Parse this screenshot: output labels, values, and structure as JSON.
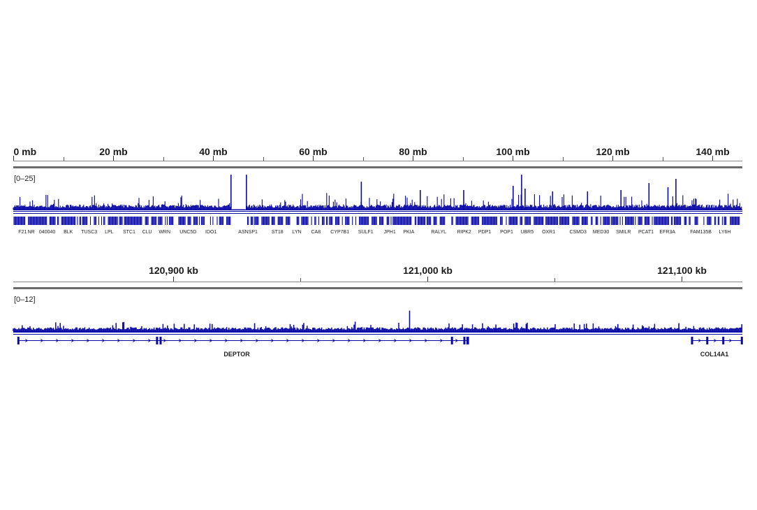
{
  "colors": {
    "signal": "#0a0aa8",
    "axis": "#4a4a4a",
    "rule": "#6b6b6b"
  },
  "chart_data": [
    {
      "type": "area",
      "title": "",
      "x_unit": "mb",
      "xlim": [
        0,
        146
      ],
      "x_ticks": [
        {
          "value": 0,
          "label": "0 mb"
        },
        {
          "value": 20,
          "label": "20 mb"
        },
        {
          "value": 40,
          "label": "40 mb"
        },
        {
          "value": 60,
          "label": "60 mb"
        },
        {
          "value": 80,
          "label": "80 mb"
        },
        {
          "value": 100,
          "label": "100 mb"
        },
        {
          "value": 120,
          "label": "120 mb"
        },
        {
          "value": 140,
          "label": "140 mb"
        }
      ],
      "data_range_label": "[0–25]",
      "ylim": [
        0,
        25
      ],
      "baseline_level": 2.5,
      "gap_region": [
        43.8,
        46.5
      ],
      "peaks": [
        {
          "x": 43.6,
          "y": 25
        },
        {
          "x": 46.7,
          "y": 25
        },
        {
          "x": 69.7,
          "y": 20
        },
        {
          "x": 101.8,
          "y": 25
        },
        {
          "x": 100.1,
          "y": 17
        },
        {
          "x": 102.5,
          "y": 15
        },
        {
          "x": 108.0,
          "y": 13
        },
        {
          "x": 90.2,
          "y": 14
        },
        {
          "x": 127.3,
          "y": 19
        },
        {
          "x": 131.1,
          "y": 16
        },
        {
          "x": 132.7,
          "y": 22
        },
        {
          "x": 115.0,
          "y": 13
        },
        {
          "x": 121.7,
          "y": 14
        },
        {
          "x": 81.5,
          "y": 14
        }
      ],
      "genes": [
        {
          "pos": 1.0,
          "label": "F21"
        },
        {
          "pos": 3.6,
          "label": "NR"
        },
        {
          "pos": 6.8,
          "label": "040040"
        },
        {
          "pos": 11.0,
          "label": "BLK"
        },
        {
          "pos": 15.2,
          "label": "TUSC3"
        },
        {
          "pos": 19.2,
          "label": "LPL"
        },
        {
          "pos": 23.2,
          "label": "STC1"
        },
        {
          "pos": 26.8,
          "label": "CLU"
        },
        {
          "pos": 30.3,
          "label": "WRN"
        },
        {
          "pos": 35.0,
          "label": "UNC5D"
        },
        {
          "pos": 39.6,
          "label": "IDO1"
        },
        {
          "pos": 47.0,
          "label": "ASNSP1"
        },
        {
          "pos": 52.9,
          "label": "ST18"
        },
        {
          "pos": 56.8,
          "label": "LYN"
        },
        {
          "pos": 60.6,
          "label": "CA8"
        },
        {
          "pos": 65.4,
          "label": "CYP7B1"
        },
        {
          "pos": 70.6,
          "label": "SULF1"
        },
        {
          "pos": 75.4,
          "label": "JPH1"
        },
        {
          "pos": 79.2,
          "label": "PKIA"
        },
        {
          "pos": 85.2,
          "label": "RALYL"
        },
        {
          "pos": 90.3,
          "label": "RIPK2"
        },
        {
          "pos": 94.4,
          "label": "PDP1"
        },
        {
          "pos": 98.8,
          "label": "POP1"
        },
        {
          "pos": 102.9,
          "label": "UBR5"
        },
        {
          "pos": 107.2,
          "label": "OXR1"
        },
        {
          "pos": 113.1,
          "label": "CSMD3"
        },
        {
          "pos": 117.7,
          "label": "MED30"
        },
        {
          "pos": 122.2,
          "label": "SMILR"
        },
        {
          "pos": 126.7,
          "label": "PCAT1"
        },
        {
          "pos": 131.0,
          "label": "EFR3A"
        },
        {
          "pos": 137.7,
          "label": "FAM135B"
        },
        {
          "pos": 142.5,
          "label": "LY6H"
        }
      ],
      "grid": false,
      "legend": "none"
    },
    {
      "type": "area",
      "title": "",
      "x_unit": "kb",
      "xlim": [
        120837,
        121124
      ],
      "x_ticks": [
        {
          "value": 120900,
          "label": "120,900 kb"
        },
        {
          "value": 121000,
          "label": "121,000 kb"
        },
        {
          "value": 121100,
          "label": "121,100 kb"
        }
      ],
      "minor_ticks": [
        120950,
        121050,
        121150
      ],
      "data_range_label": "[0–12]",
      "ylim": [
        0,
        12
      ],
      "baseline_level": 1.2,
      "peaks": [
        {
          "x": 120932,
          "y": 3.6
        },
        {
          "x": 120946,
          "y": 3.2
        },
        {
          "x": 120993,
          "y": 9.3
        },
        {
          "x": 121034,
          "y": 3.4
        },
        {
          "x": 121027,
          "y": 3.0
        },
        {
          "x": 121039,
          "y": 3.0
        },
        {
          "x": 121075,
          "y": 3.2
        },
        {
          "x": 121099,
          "y": 3.6
        },
        {
          "x": 121140,
          "y": 3.4
        },
        {
          "x": 121081,
          "y": 3.0
        }
      ],
      "genes": [
        {
          "name": "DEPTOR",
          "label_pos": 120925,
          "start": 120839,
          "end": 121016,
          "strand": "+",
          "exons": [
            120839,
            120893.6,
            120895.0,
            121009.7,
            121014.6,
            121015.8,
            121016
          ]
        },
        {
          "name": "COL14A1",
          "label_pos": 121113,
          "start": 121104,
          "end": 121124,
          "strand": "+",
          "exons": [
            121104.2,
            121110.2,
            121116.5,
            121123.8
          ]
        }
      ],
      "grid": false,
      "legend": "none"
    }
  ]
}
